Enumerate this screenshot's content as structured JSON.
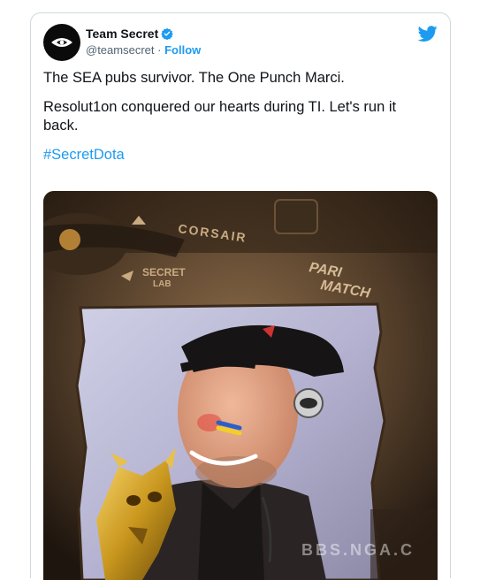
{
  "tweet": {
    "display_name": "Team Secret",
    "handle": "@teamsecret",
    "separator": "·",
    "follow_label": "Follow",
    "line1": "The SEA pubs survivor. The One Punch Marci.",
    "line2": "Resolut1on conquered our hearts during TI. Let's run it back.",
    "hashtag": "#SecretDota"
  },
  "media": {
    "sponsor_1": "CORSAIR",
    "sponsor_2a": "SECRET",
    "sponsor_2b": "LAB",
    "sponsor_3a": "PARI",
    "sponsor_3b": "MATCH",
    "watermark": "BBS.NGA.C"
  },
  "colors": {
    "link": "#1d9bf0",
    "muted": "#536471",
    "border": "#cfd9de"
  }
}
